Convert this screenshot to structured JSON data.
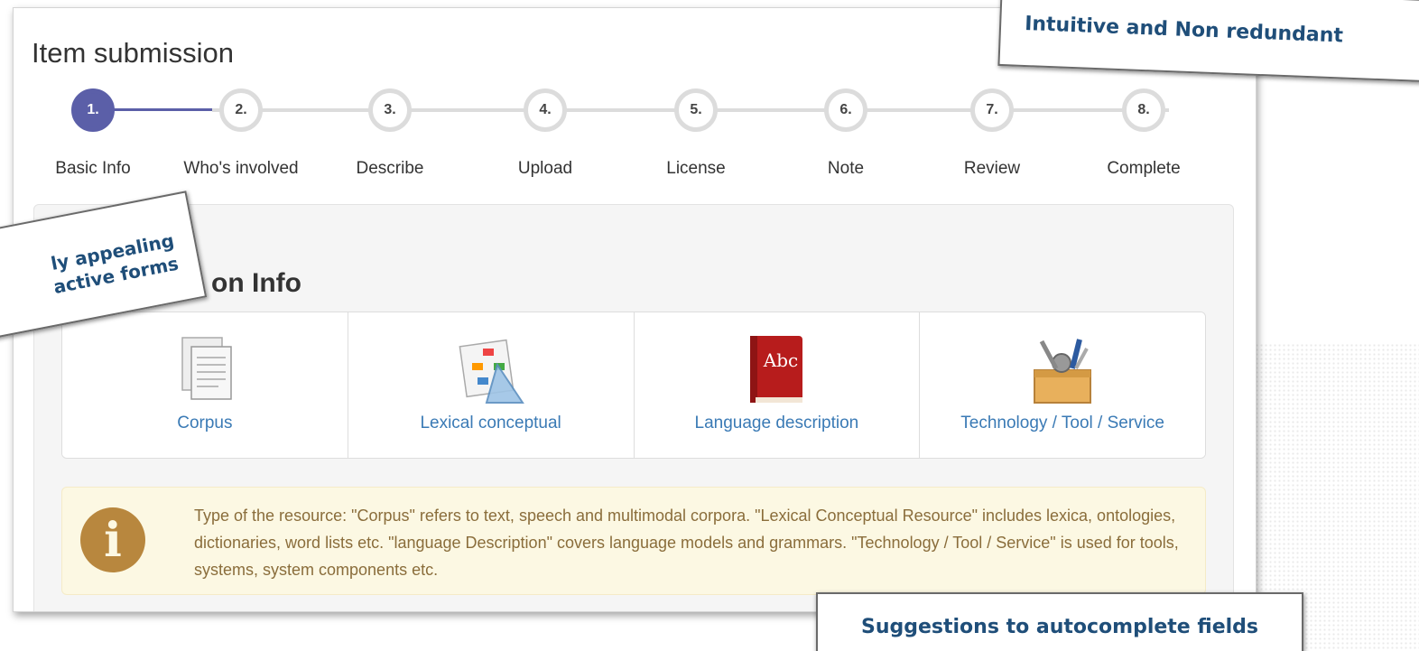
{
  "page": {
    "title": "Item submission",
    "section_title": "on Info"
  },
  "steps": [
    {
      "number": "1.",
      "label": "Basic Info",
      "active": true
    },
    {
      "number": "2.",
      "label": "Who's involved",
      "active": false
    },
    {
      "number": "3.",
      "label": "Describe",
      "active": false
    },
    {
      "number": "4.",
      "label": "Upload",
      "active": false
    },
    {
      "number": "5.",
      "label": "License",
      "active": false
    },
    {
      "number": "6.",
      "label": "Note",
      "active": false
    },
    {
      "number": "7.",
      "label": "Review",
      "active": false
    },
    {
      "number": "8.",
      "label": "Complete",
      "active": false
    }
  ],
  "resource_types": [
    {
      "label": "Corpus",
      "icon": "documents-icon"
    },
    {
      "label": "Lexical conceptual",
      "icon": "diagram-icon"
    },
    {
      "label": "Language description",
      "icon": "book-icon"
    },
    {
      "label": "Technology / Tool / Service",
      "icon": "toolbox-icon"
    }
  ],
  "book_icon_text": "Abc",
  "info": {
    "icon_glyph": "i",
    "text": "Type of the resource: \"Corpus\" refers to text, speech and multimodal corpora. \"Lexical Conceptual Resource\" includes lexica, ontologies, dictionaries, word lists etc. \"language Description\" covers language models and grammars. \"Technology / Tool / Service\" is used for tools, systems, system components etc."
  },
  "annotations": {
    "top": "Intuitive and Non redundant",
    "left_line1": "ly appealing",
    "left_line2": "active forms",
    "bottom": "Suggestions to autocomplete fields"
  },
  "colors": {
    "step_active": "#5b5fa8",
    "link": "#3a7ab5",
    "info_bg": "#fcf8e3",
    "info_text": "#8a6d3b",
    "annotation_text": "#1f4e79"
  }
}
